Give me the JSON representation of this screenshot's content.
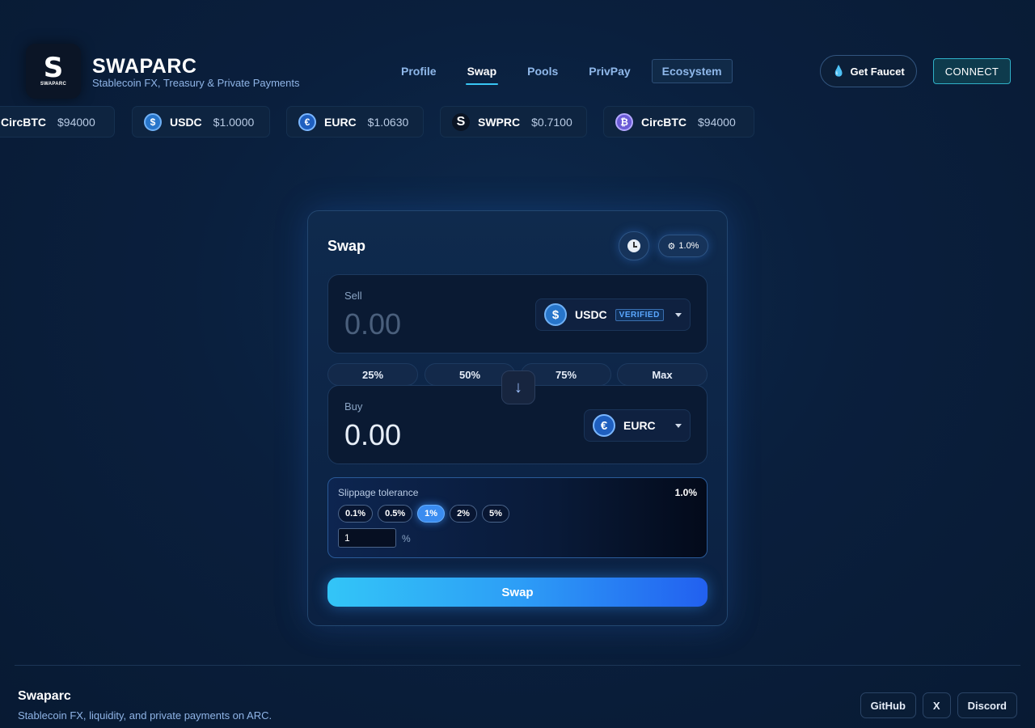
{
  "brand": {
    "logo_letter": "S",
    "logo_word": "SWAPARC",
    "title": "SWAPARC",
    "subtitle": "Stablecoin FX, Treasury & Private Payments"
  },
  "nav": {
    "items": [
      {
        "label": "Profile"
      },
      {
        "label": "Swap",
        "active": true
      },
      {
        "label": "Pools"
      },
      {
        "label": "PrivPay"
      },
      {
        "label": "Ecosystem"
      }
    ]
  },
  "header": {
    "faucet_label": "Get Faucet",
    "connect_label": "CONNECT"
  },
  "ticker": [
    {
      "symbol": "CircBTC",
      "price": "$94000"
    },
    {
      "symbol": "USDC",
      "price": "$1.0000"
    },
    {
      "symbol": "EURC",
      "price": "$1.0630"
    },
    {
      "symbol": "SWPRC",
      "price": "$0.7100"
    },
    {
      "symbol": "CircBTC",
      "price": "$94000"
    }
  ],
  "swap": {
    "title": "Swap",
    "slippage_chip": "1.0%",
    "sell": {
      "label": "Sell",
      "placeholder": "0.00",
      "token": "USDC",
      "badge": "VERIFIED"
    },
    "percent_buttons": [
      "25%",
      "50%",
      "75%",
      "Max"
    ],
    "buy": {
      "label": "Buy",
      "value": "0.00",
      "token": "EURC"
    },
    "slippage": {
      "title": "Slippage tolerance",
      "value": "1.0%",
      "options": [
        "0.1%",
        "0.5%",
        "1%",
        "2%",
        "5%"
      ],
      "selected": "1%",
      "input_value": "1",
      "unit": "%"
    },
    "submit_label": "Swap"
  },
  "footer": {
    "title": "Swaparc",
    "subtitle": "Stablecoin FX, liquidity, and private payments on ARC.",
    "links": [
      "GitHub",
      "X",
      "Discord"
    ]
  },
  "colors": {
    "accent": "#38c6f4",
    "background": "#0a1f3d",
    "swap_gradient_start": "#33c5f7",
    "swap_gradient_end": "#2260f0"
  }
}
